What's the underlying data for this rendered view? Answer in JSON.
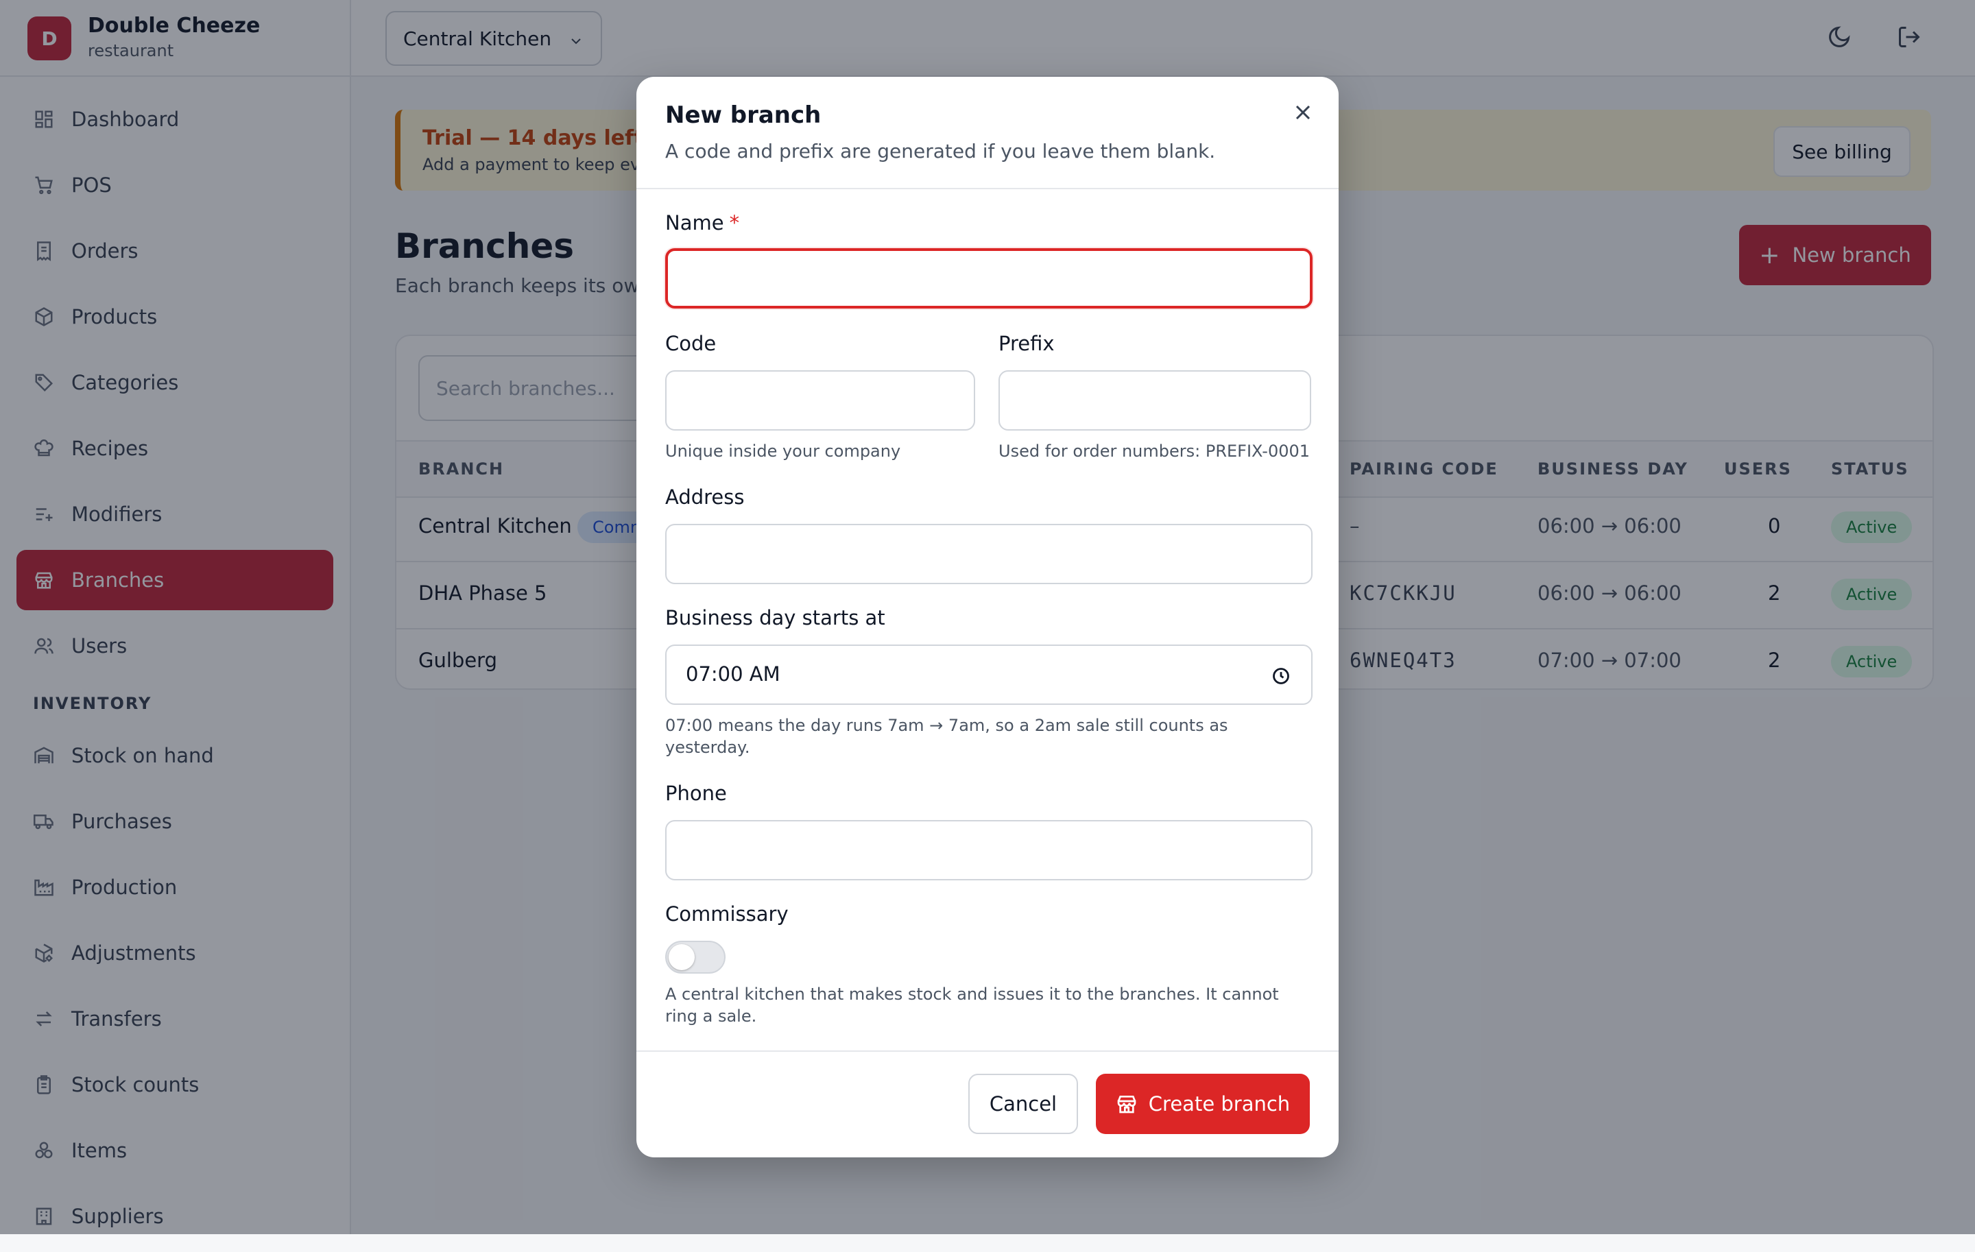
{
  "brand": {
    "initial": "D",
    "name": "Double Cheeze",
    "subtitle": "restaurant"
  },
  "sidebar": {
    "items": [
      {
        "label": "Dashboard",
        "icon": "dashboard-icon"
      },
      {
        "label": "POS",
        "icon": "cart-icon"
      },
      {
        "label": "Orders",
        "icon": "receipt-icon"
      },
      {
        "label": "Products",
        "icon": "box-icon"
      },
      {
        "label": "Categories",
        "icon": "tag-icon"
      },
      {
        "label": "Recipes",
        "icon": "chef-hat-icon"
      },
      {
        "label": "Modifiers",
        "icon": "list-plus-icon"
      },
      {
        "label": "Branches",
        "icon": "store-icon",
        "active": true
      },
      {
        "label": "Users",
        "icon": "users-icon"
      }
    ],
    "inventory_heading": "INVENTORY",
    "inventory_items": [
      {
        "label": "Stock on hand",
        "icon": "warehouse-icon"
      },
      {
        "label": "Purchases",
        "icon": "truck-icon"
      },
      {
        "label": "Production",
        "icon": "factory-icon"
      },
      {
        "label": "Adjustments",
        "icon": "package-edit-icon"
      },
      {
        "label": "Transfers",
        "icon": "arrows-swap-icon"
      },
      {
        "label": "Stock counts",
        "icon": "clipboard-icon"
      },
      {
        "label": "Items",
        "icon": "cubes-icon"
      },
      {
        "label": "Suppliers",
        "icon": "building-icon"
      }
    ]
  },
  "topbar": {
    "branch_selected": "Central Kitchen"
  },
  "trial": {
    "title": "Trial — 14 days left",
    "subtitle": "Add a payment to keep ev",
    "billing_label": "See billing"
  },
  "page": {
    "title": "Branches",
    "subtitle": "Each branch keeps its ow",
    "new_button": "New branch"
  },
  "table": {
    "search_placeholder": "Search branches...",
    "columns": {
      "branch": "BRANCH",
      "pairing": "PAIRING CODE",
      "business_day": "BUSINESS DAY",
      "users": "USERS",
      "status": "STATUS"
    },
    "rows": [
      {
        "branch": "Central Kitchen",
        "badge": "Comm",
        "pairing": "–",
        "business_day": "06:00 → 06:00",
        "users": "0",
        "status": "Active"
      },
      {
        "branch": "DHA Phase 5",
        "pairing": "KC7CKKJU",
        "business_day": "06:00 → 06:00",
        "users": "2",
        "status": "Active"
      },
      {
        "branch": "Gulberg",
        "pairing": "6WNEQ4T3",
        "business_day": "07:00 → 07:00",
        "users": "2",
        "status": "Active"
      }
    ]
  },
  "modal": {
    "title": "New branch",
    "subtitle": "A code and prefix are generated if you leave them blank.",
    "name_label": "Name",
    "required_mark": "*",
    "name_value": "",
    "code_label": "Code",
    "code_hint": "Unique inside your company",
    "prefix_label": "Prefix",
    "prefix_hint": "Used for order numbers: PREFIX-0001",
    "address_label": "Address",
    "business_day_label": "Business day starts at",
    "business_day_value": "07:00 AM",
    "business_day_hint": "07:00 means the day runs 7am → 7am, so a 2am sale still counts as yesterday.",
    "phone_label": "Phone",
    "commissary_label": "Commissary",
    "commissary_on": false,
    "commissary_hint": "A central kitchen that makes stock and issues it to the branches. It cannot ring a sale.",
    "cancel_label": "Cancel",
    "create_label": "Create branch"
  },
  "colors": {
    "brand_red": "#c0263a",
    "danger": "#dc2626",
    "trial_bg": "#fdf6d8",
    "trial_accent": "#d97706"
  }
}
